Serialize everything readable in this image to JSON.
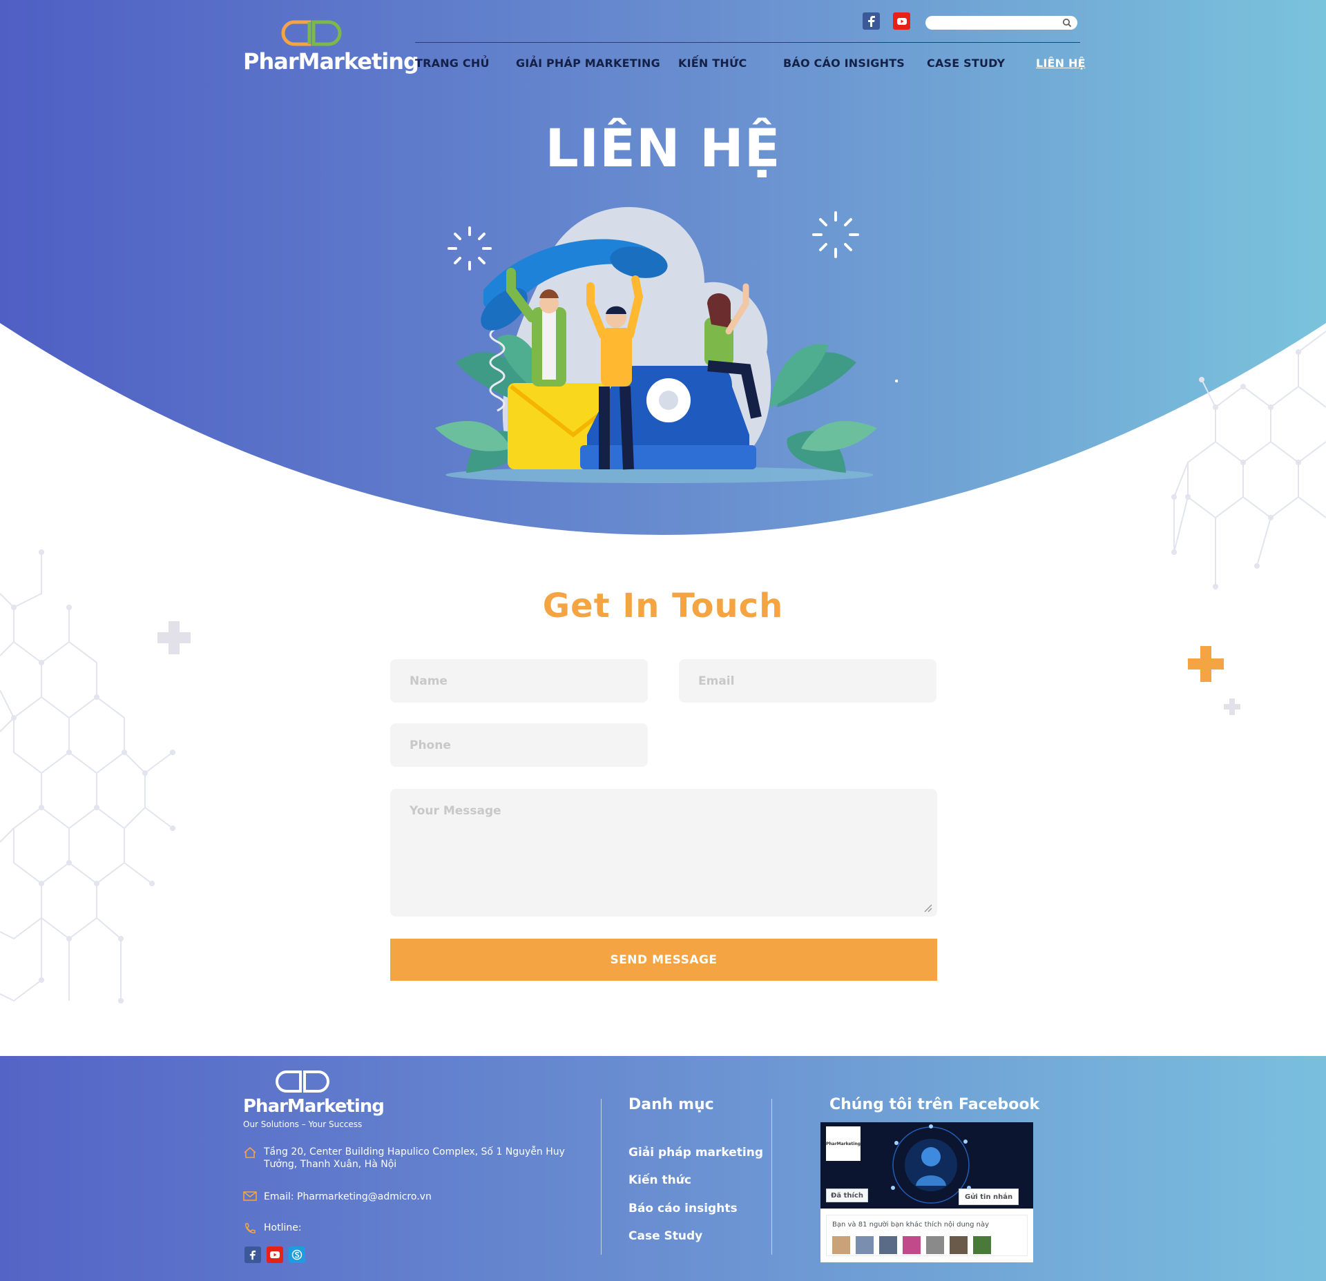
{
  "brand": {
    "name": "PharMarketing",
    "tagline": "Our Solutions – Your Success",
    "colors": {
      "orange": "#f4a442",
      "green": "#7cb84a",
      "navy": "#152046",
      "hero_start": "#4f5fc4",
      "hero_end": "#7ac3dc"
    }
  },
  "header": {
    "social": [
      {
        "name": "facebook",
        "icon": "facebook-icon"
      },
      {
        "name": "youtube",
        "icon": "youtube-icon"
      }
    ],
    "search": {
      "placeholder": "",
      "icon": "search-icon"
    },
    "nav": [
      {
        "label": "TRANG CHỦ",
        "active": false
      },
      {
        "label": "GIẢI PHÁP MARKETING",
        "active": false
      },
      {
        "label": "KIẾN THỨC",
        "active": false
      },
      {
        "label": "BÁO CÁO INSIGHTS",
        "active": false
      },
      {
        "label": "CASE STUDY",
        "active": false
      },
      {
        "label": "LIÊN HỆ",
        "active": true
      }
    ]
  },
  "hero": {
    "title": "LIÊN HỆ",
    "illustration": "people-with-giant-telephone-and-envelope"
  },
  "contact_form": {
    "title": "Get In Touch",
    "fields": {
      "name": {
        "placeholder": "Name",
        "value": ""
      },
      "email": {
        "placeholder": "Email",
        "value": ""
      },
      "phone": {
        "placeholder": "Phone",
        "value": ""
      },
      "message": {
        "placeholder": "Your Message",
        "value": ""
      }
    },
    "submit_label": "SEND MESSAGE"
  },
  "footer": {
    "address": "Tầng 20, Center Building Hapulico Complex, Số 1 Nguyễn Huy Tưởng, Thanh Xuân, Hà Nội",
    "email": "Email: Pharmarketing@admicro.vn",
    "hotline": "Hotline:",
    "social": [
      "facebook-icon",
      "youtube-icon",
      "skype-icon"
    ],
    "menu_title": "Danh mục",
    "menu": [
      "Giải pháp marketing",
      "Kiến thức",
      "Báo cáo insights",
      "Case Study"
    ],
    "facebook_title": "Chúng tôi trên Facebook",
    "fb_widget": {
      "liked_label": "Đã thích",
      "message_label": "Gửi tin nhắn",
      "friends_text": "Bạn và 81 người bạn khác thích nội dung này",
      "page_logo_text": "PharMarketing"
    }
  }
}
